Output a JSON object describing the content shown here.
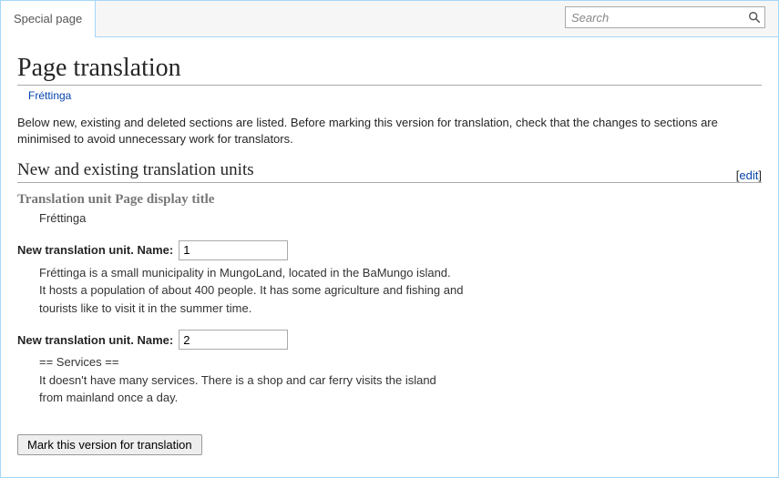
{
  "topbar": {
    "tab_label": "Special page",
    "search_placeholder": "Search"
  },
  "header": {
    "title": "Page translation",
    "subtitle": "Fréttinga",
    "description": "Below new, existing and deleted sections are listed. Before marking this version for translation, check that the changes to sections are minimised to avoid unnecessary work for translators."
  },
  "section": {
    "heading": "New and existing translation units",
    "edit_label": "edit"
  },
  "display_title_unit": {
    "label": "Translation unit Page display title",
    "value": "Fréttinga"
  },
  "new_unit_label": "New translation unit. Name:",
  "units": [
    {
      "name": "1",
      "body": "Fréttinga is a small municipality in MungoLand, located in the BaMungo island.\nIt hosts a population of about 400 people. It has some agriculture and fishing and\ntourists like to visit it in the summer time."
    },
    {
      "name": "2",
      "body": "== Services ==\nIt doesn't have many services. There is a shop and car ferry visits the island\nfrom mainland once a day."
    }
  ],
  "submit": {
    "label": "Mark this version for translation"
  }
}
